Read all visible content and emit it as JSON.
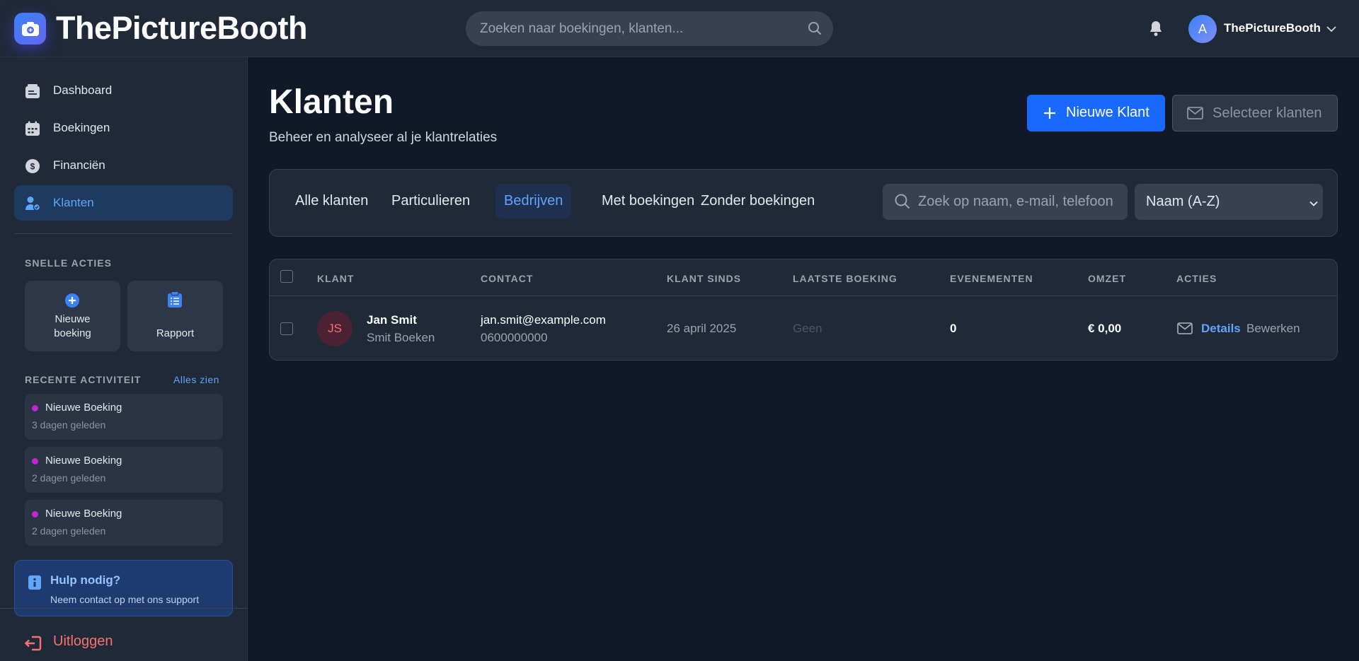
{
  "app": {
    "name": "ThePictureBooth"
  },
  "header": {
    "search_placeholder": "Zoeken naar boekingen, klanten...",
    "user": {
      "initial": "A",
      "name": "ThePictureBooth"
    }
  },
  "sidebar": {
    "items": [
      {
        "label": "Dashboard",
        "icon": "dashboard-icon"
      },
      {
        "label": "Boekingen",
        "icon": "calendar-icon"
      },
      {
        "label": "Financiën",
        "icon": "money-icon"
      },
      {
        "label": "Klanten",
        "icon": "users-icon",
        "active": true
      }
    ],
    "quick_actions_title": "SNELLE ACTIES",
    "quick_actions": [
      {
        "label_line1": "Nieuwe",
        "label_line2": "boeking",
        "icon": "plus-circle-icon"
      },
      {
        "label": "Rapport",
        "icon": "clipboard-icon"
      }
    ],
    "recent_title": "RECENTE ACTIVITEIT",
    "see_all": "Alles zien",
    "recent": [
      {
        "title": "Nieuwe Boeking",
        "time": "3 dagen geleden"
      },
      {
        "title": "Nieuwe Boeking",
        "time": "2 dagen geleden"
      },
      {
        "title": "Nieuwe Boeking",
        "time": "2 dagen geleden"
      }
    ],
    "help": {
      "title": "Hulp nodig?",
      "subtitle": "Neem contact op met ons support"
    },
    "logout": "Uitloggen"
  },
  "main": {
    "title": "Klanten",
    "subtitle": "Beheer en analyseer al je klantrelaties",
    "new_button": "Nieuwe Klant",
    "select_button": "Selecteer klanten",
    "tabs": [
      {
        "label": "Alle klanten"
      },
      {
        "label": "Particulieren"
      },
      {
        "label": "Bedrijven",
        "active": true
      },
      {
        "label": "Met boekingen"
      },
      {
        "label": "Zonder boekingen"
      }
    ],
    "filter_search_placeholder": "Zoek op naam, e-mail, telefoon",
    "sort_value": "Naam (A-Z)",
    "table": {
      "columns": [
        "KLANT",
        "CONTACT",
        "KLANT SINDS",
        "LAATSTE BOEKING",
        "EVENEMENTEN",
        "OMZET",
        "ACTIES"
      ],
      "rows": [
        {
          "initials": "JS",
          "name": "Jan Smit",
          "company": "Smit Boeken",
          "email": "jan.smit@example.com",
          "phone": "0600000000",
          "since": "26 april 2025",
          "last_booking": "Geen",
          "events": "0",
          "revenue": "€ 0,00",
          "action_details": "Details",
          "action_edit": "Bewerken"
        }
      ]
    }
  },
  "colors": {
    "accent": "#1769ff",
    "link": "#60a5fa",
    "danger": "#f87171",
    "bg": "#111827",
    "panel": "#1f2937"
  }
}
